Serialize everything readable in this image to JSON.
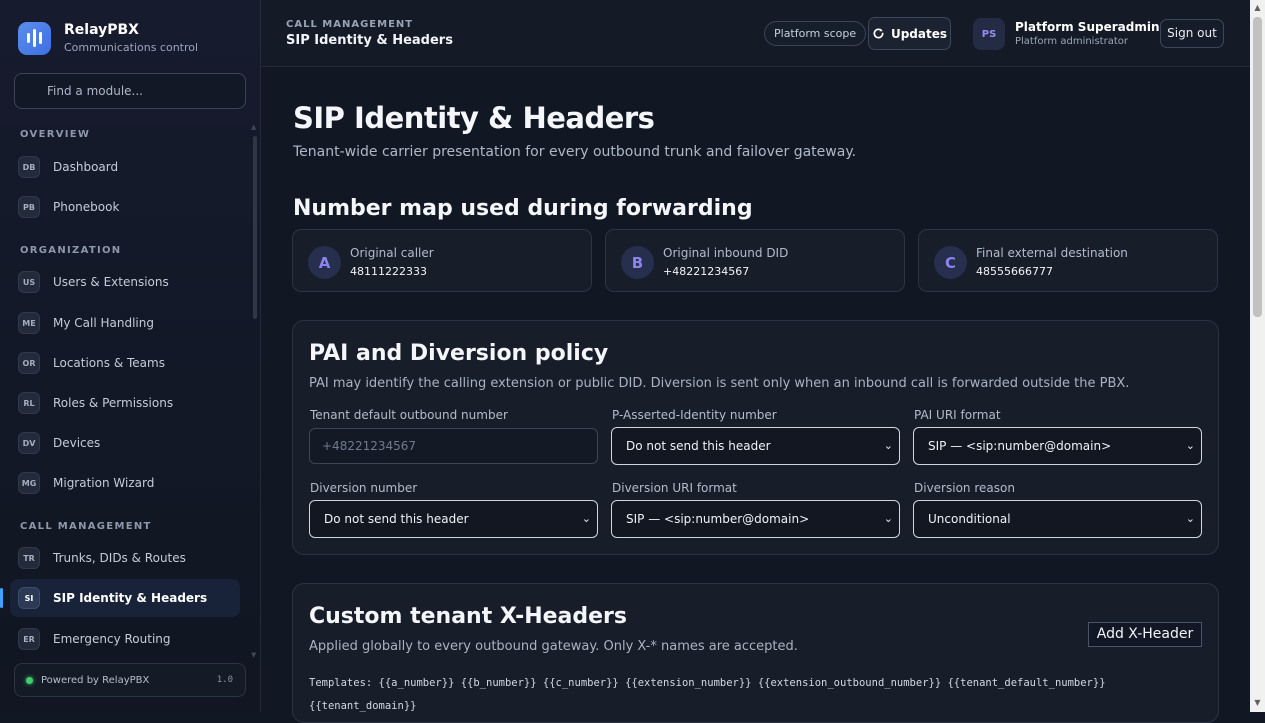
{
  "brand": {
    "name": "RelayPBX",
    "subtitle": "Communications control"
  },
  "module_search": {
    "placeholder": "Find a module..."
  },
  "nav": {
    "sections": [
      "OVERVIEW",
      "ORGANIZATION",
      "CALL MANAGEMENT"
    ],
    "items": [
      {
        "badge": "DB",
        "label": "Dashboard"
      },
      {
        "badge": "PB",
        "label": "Phonebook"
      },
      {
        "badge": "US",
        "label": "Users & Extensions"
      },
      {
        "badge": "ME",
        "label": "My Call Handling"
      },
      {
        "badge": "OR",
        "label": "Locations & Teams"
      },
      {
        "badge": "RL",
        "label": "Roles & Permissions"
      },
      {
        "badge": "DV",
        "label": "Devices"
      },
      {
        "badge": "MG",
        "label": "Migration Wizard"
      },
      {
        "badge": "TR",
        "label": "Trunks, DIDs & Routes"
      },
      {
        "badge": "SI",
        "label": "SIP Identity & Headers",
        "active": true
      },
      {
        "badge": "ER",
        "label": "Emergency Routing"
      }
    ]
  },
  "footer": {
    "powered": "Powered by RelayPBX",
    "version": "1.0"
  },
  "header": {
    "section": "CALL MANAGEMENT",
    "title": "SIP Identity & Headers",
    "scope": "Platform scope",
    "updates": "Updates",
    "avatar_initials": "PS",
    "user_name": "Platform Superadmin",
    "user_role": "Platform administrator",
    "sign_out": "Sign out"
  },
  "page": {
    "title": "SIP Identity & Headers",
    "subtitle": "Tenant-wide carrier presentation for every outbound trunk and failover gateway."
  },
  "number_map": {
    "title": "Number map used during forwarding",
    "cards": [
      {
        "letter": "A",
        "label": "Original caller",
        "value": "48111222333"
      },
      {
        "letter": "B",
        "label": "Original inbound DID",
        "value": "+48221234567"
      },
      {
        "letter": "C",
        "label": "Final external destination",
        "value": "48555666777"
      }
    ]
  },
  "policy": {
    "title": "PAI and Diversion policy",
    "description": "PAI may identify the calling extension or public DID. Diversion is sent only when an inbound call is forwarded outside the PBX.",
    "fields": {
      "default_number": {
        "label": "Tenant default outbound number",
        "placeholder": "+48221234567"
      },
      "pai_number": {
        "label": "P-Asserted-Identity number",
        "value": "Do not send this header"
      },
      "pai_uri": {
        "label": "PAI URI format",
        "value": "SIP — <sip:number@domain>"
      },
      "diversion_number": {
        "label": "Diversion number",
        "value": "Do not send this header"
      },
      "diversion_uri": {
        "label": "Diversion URI format",
        "value": "SIP — <sip:number@domain>"
      },
      "diversion_reason": {
        "label": "Diversion reason",
        "value": "Unconditional"
      }
    }
  },
  "xheaders": {
    "title": "Custom tenant X-Headers",
    "description": "Applied globally to every outbound gateway. Only X-* names are accepted.",
    "add_button": "Add X-Header",
    "templates": "Templates: {{a_number}} {{b_number}} {{c_number}} {{extension_number}} {{extension_outbound_number}} {{tenant_default_number}} {{tenant_domain}}"
  }
}
